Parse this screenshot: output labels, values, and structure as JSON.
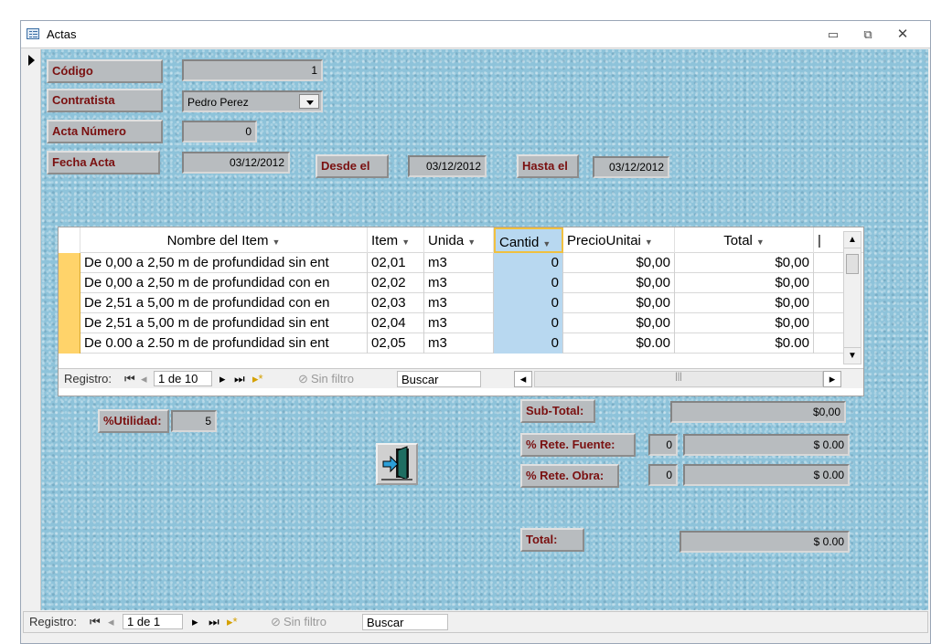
{
  "window": {
    "title": "Actas"
  },
  "form": {
    "codigo": {
      "label": "Código",
      "value": "1"
    },
    "contratista": {
      "label": "Contratista",
      "value": "Pedro Perez"
    },
    "acta_numero": {
      "label": "Acta Número",
      "value": "0"
    },
    "fecha_acta": {
      "label": "Fecha Acta",
      "value": "03/12/2012"
    },
    "desde": {
      "label": "Desde el",
      "value": "03/12/2012"
    },
    "hasta": {
      "label": "Hasta el",
      "value": "03/12/2012"
    },
    "utilidad": {
      "label": "%Utilidad:",
      "value": "5"
    },
    "subtotal": {
      "label": "Sub-Total:",
      "value": "$0,00"
    },
    "rete_fuente": {
      "label": "% Rete. Fuente:",
      "pct": "0",
      "value": "$ 0.00"
    },
    "rete_obra": {
      "label": "% Rete. Obra:",
      "pct": "0",
      "value": "$ 0.00"
    },
    "total": {
      "label": "Total:",
      "value": "$ 0.00"
    }
  },
  "grid": {
    "columns": [
      "Nombre del Item",
      "Item",
      "Unida",
      "Cantid",
      "PrecioUnitai",
      "Total"
    ],
    "rows": [
      {
        "nombre": "De 0,00 a 2,50 m de profundidad sin ent",
        "item": "02,01",
        "unidad": "m3",
        "cantidad": "0",
        "precio": "$0,00",
        "total": "$0,00"
      },
      {
        "nombre": "De 0,00 a 2,50 m de profundidad con en",
        "item": "02,02",
        "unidad": "m3",
        "cantidad": "0",
        "precio": "$0,00",
        "total": "$0,00"
      },
      {
        "nombre": "De 2,51 a 5,00 m de profundidad con en",
        "item": "02,03",
        "unidad": "m3",
        "cantidad": "0",
        "precio": "$0,00",
        "total": "$0,00"
      },
      {
        "nombre": "De 2,51 a 5,00 m de profundidad sin ent",
        "item": "02,04",
        "unidad": "m3",
        "cantidad": "0",
        "precio": "$0,00",
        "total": "$0,00"
      },
      {
        "nombre": "De 0.00 a 2.50 m de profundidad sin ent",
        "item": "02,05",
        "unidad": "m3",
        "cantidad": "0",
        "precio": "$0.00",
        "total": "$0.00"
      }
    ],
    "nav": {
      "label": "Registro:",
      "position": "1 de 10",
      "filter": "Sin filtro",
      "search": "Buscar"
    }
  },
  "bottom_nav": {
    "label": "Registro:",
    "position": "1 de 1",
    "filter": "Sin filtro",
    "search": "Buscar"
  },
  "icons": {
    "exit": "exit-door-icon"
  }
}
